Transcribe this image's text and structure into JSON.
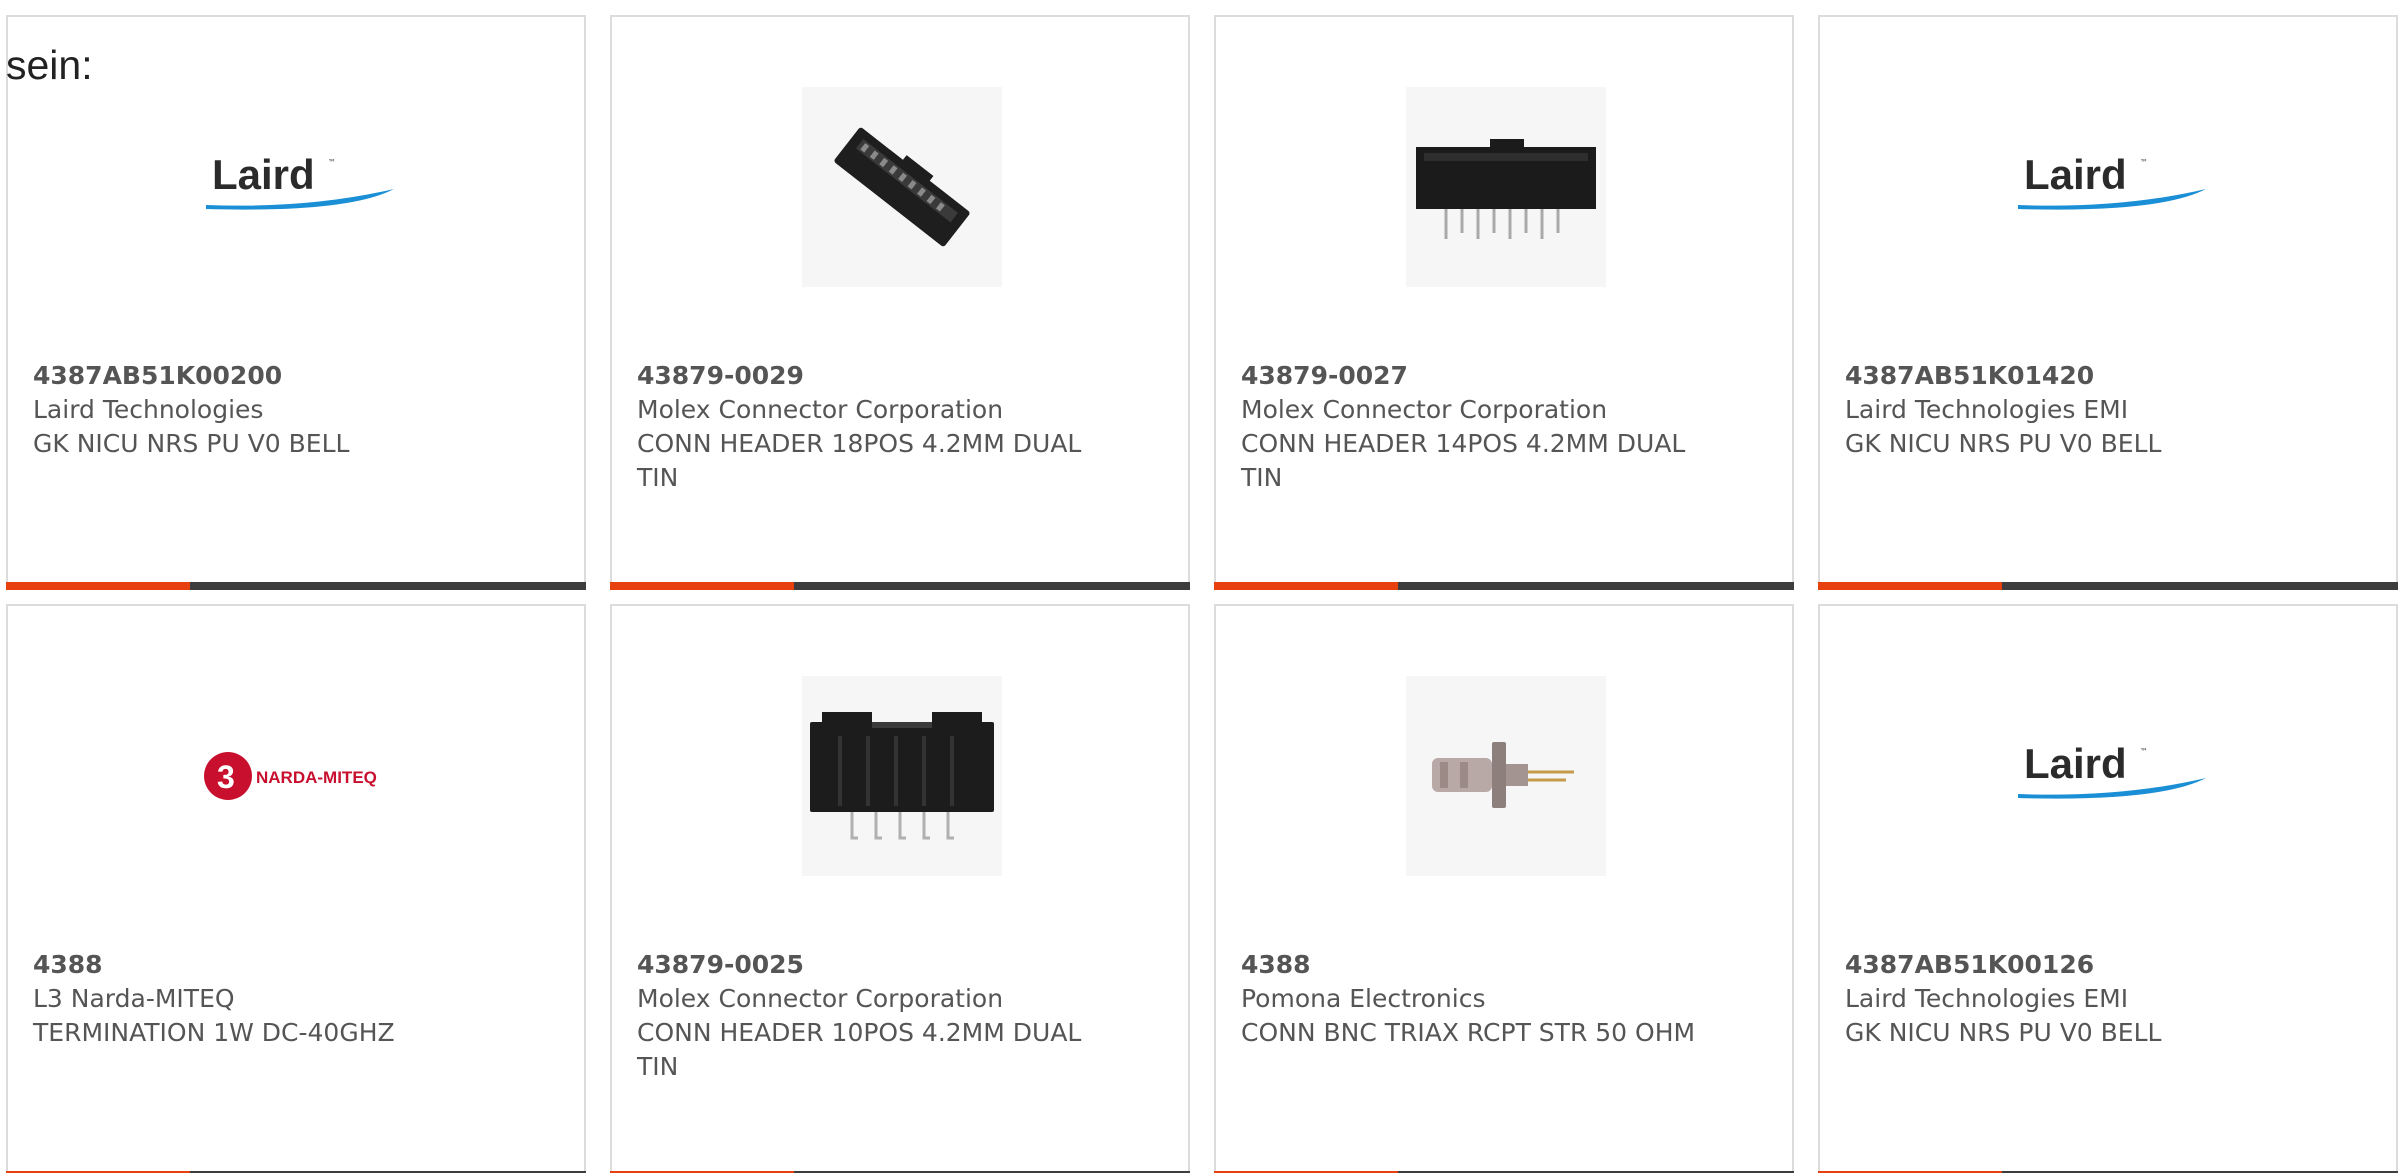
{
  "intro": {
    "text": "sein:"
  },
  "brand": {
    "accent_color": "#e84110",
    "bar_color": "#3d3d3d",
    "laird_logo_text": "Laird",
    "narda_logo_text": "NARDA-MITEQ",
    "narda_logo_badge": "3"
  },
  "products": [
    {
      "part_number": "4387AB51K00200",
      "manufacturer": "Laird Technologies",
      "description": "GK NICU NRS PU V0 BELL",
      "image": "laird-logo"
    },
    {
      "part_number": "43879-0029",
      "manufacturer": "Molex Connector Corporation",
      "description": "CONN HEADER 18POS 4.2MM DUAL TIN",
      "image": "connector-angled-photo"
    },
    {
      "part_number": "43879-0027",
      "manufacturer": "Molex Connector Corporation",
      "description": "CONN HEADER 14POS 4.2MM DUAL TIN",
      "image": "connector-14pos-photo"
    },
    {
      "part_number": "4387AB51K01420",
      "manufacturer": "Laird Technologies EMI",
      "description": "GK NICU NRS PU V0 BELL",
      "image": "laird-logo"
    },
    {
      "part_number": "4388",
      "manufacturer": "L3 Narda-MITEQ",
      "description": "TERMINATION 1W DC-40GHZ",
      "image": "narda-miteq-logo"
    },
    {
      "part_number": "43879-0025",
      "manufacturer": "Molex Connector Corporation",
      "description": "CONN HEADER 10POS 4.2MM DUAL TIN",
      "image": "connector-10pos-photo"
    },
    {
      "part_number": "4388",
      "manufacturer": "Pomona Electronics",
      "description": "CONN BNC TRIAX RCPT STR 50 OHM",
      "image": "bnc-triax-photo"
    },
    {
      "part_number": "4387AB51K00126",
      "manufacturer": "Laird Technologies EMI",
      "description": "GK NICU NRS PU V0 BELL",
      "image": "laird-logo"
    }
  ]
}
